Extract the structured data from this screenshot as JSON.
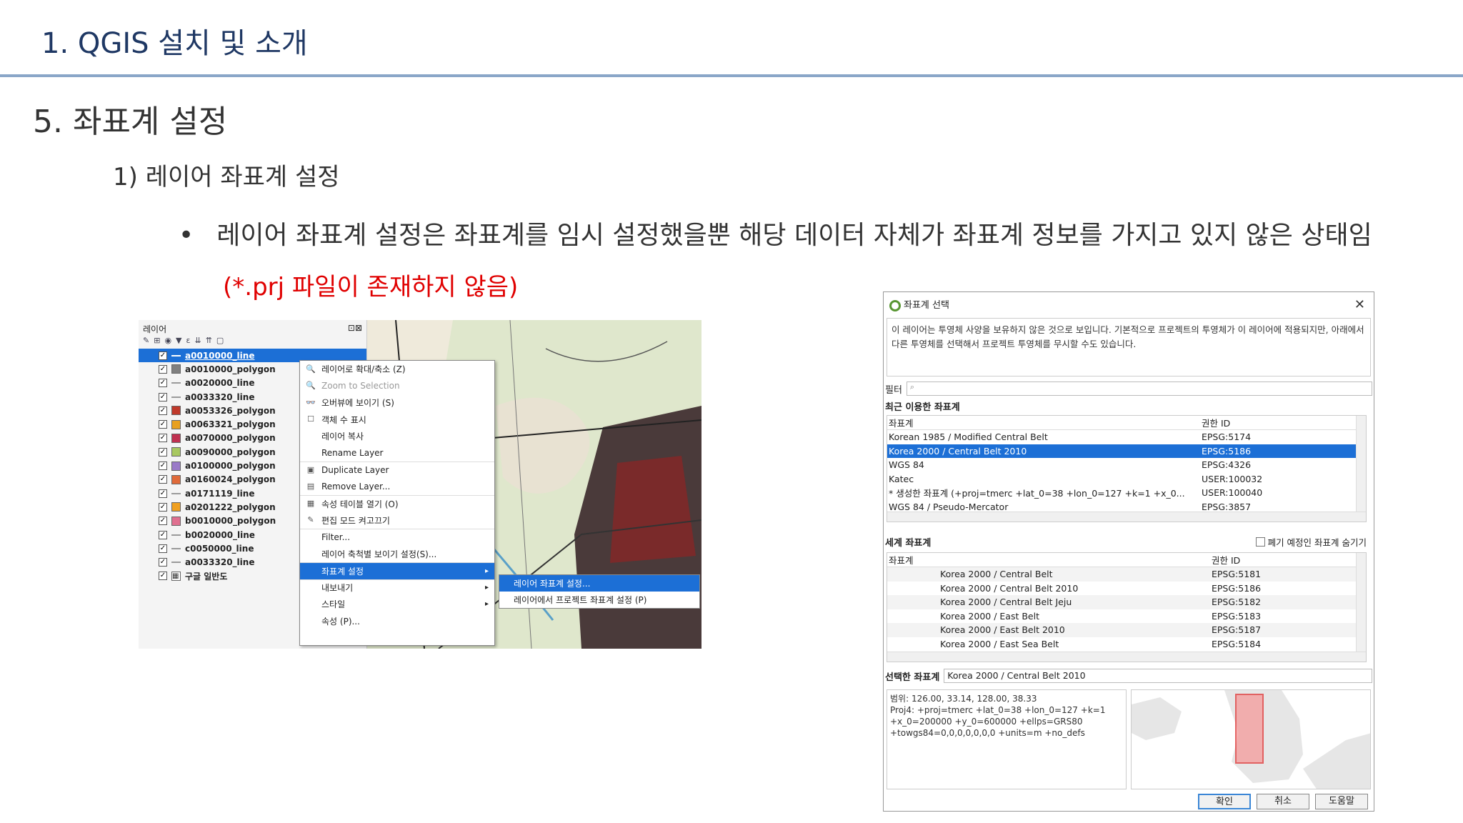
{
  "header": {
    "title": "1. QGIS 설치 및 소개"
  },
  "section": {
    "title": "5. 좌표계 설정",
    "subtitle": "1) 레이어 좌표계 설정"
  },
  "bullet": {
    "text": "레이어 좌표계 설정은  좌표계를 임시 설정했을뿐 해당 데이터 자체가 좌표계 정보를 가지고 있지 않은 상태임",
    "note": "(*.prj 파일이 존재하지 않음)"
  },
  "layers_panel": {
    "title": "레이어",
    "layers": [
      {
        "name": "a0010000_line",
        "type": "line",
        "color": "#ffffff",
        "selected": true
      },
      {
        "name": "a0010000_polygon",
        "type": "polygon",
        "color": "#808080"
      },
      {
        "name": "a0020000_line",
        "type": "line",
        "color": "#9a9a9a"
      },
      {
        "name": "a0033320_line",
        "type": "line",
        "color": "#9a9a9a"
      },
      {
        "name": "a0053326_polygon",
        "type": "polygon",
        "color": "#c0392b"
      },
      {
        "name": "a0063321_polygon",
        "type": "polygon",
        "color": "#e8a020"
      },
      {
        "name": "a0070000_polygon",
        "type": "polygon",
        "color": "#c03050"
      },
      {
        "name": "a0090000_polygon",
        "type": "polygon",
        "color": "#a8c860"
      },
      {
        "name": "a0100000_polygon",
        "type": "polygon",
        "color": "#9a7ac8"
      },
      {
        "name": "a0160024_polygon",
        "type": "polygon",
        "color": "#e06a3a"
      },
      {
        "name": "a0171119_line",
        "type": "line",
        "color": "#9a9a9a"
      },
      {
        "name": "a0201222_polygon",
        "type": "polygon",
        "color": "#f0a020"
      },
      {
        "name": "b0010000_polygon",
        "type": "polygon",
        "color": "#e07090"
      },
      {
        "name": "b0020000_line",
        "type": "line",
        "color": "#9a9a9a"
      },
      {
        "name": "c0050000_line",
        "type": "line",
        "color": "#9a9a9a"
      },
      {
        "name": "a0033320_line",
        "type": "line",
        "color": "#9a9a9a"
      },
      {
        "name": "구글 일반도",
        "type": "raster",
        "color": "#333333"
      }
    ]
  },
  "context_menu": {
    "items": [
      {
        "label": "레이어로 확대/축소 (Z)",
        "icon": "zoom-icon"
      },
      {
        "label": "Zoom to Selection",
        "icon": "zoom-selection-icon",
        "disabled": true
      },
      {
        "label": "오버뷰에 보이기 (S)",
        "icon": "overview-icon"
      },
      {
        "label": "객체 수 표시",
        "icon": "checkbox-icon"
      },
      {
        "label": "레이어 복사",
        "icon": ""
      },
      {
        "label": "Rename Layer",
        "icon": ""
      },
      {
        "label": "Duplicate Layer",
        "icon": "duplicate-icon"
      },
      {
        "label": "Remove Layer...",
        "icon": "remove-icon"
      },
      {
        "label": "속성 테이블 열기 (O)",
        "icon": "table-icon"
      },
      {
        "label": "편집 모드 켜고끄기",
        "icon": "pencil-icon"
      },
      {
        "label": "Filter...",
        "icon": ""
      },
      {
        "label": "레이어 축척별 보이기 설정(S)...",
        "icon": ""
      },
      {
        "label": "좌표계 설정",
        "icon": "",
        "highlight": true,
        "submenu": true
      },
      {
        "label": "내보내기",
        "icon": "",
        "submenu": true
      },
      {
        "label": "스타일",
        "icon": "",
        "submenu": true
      },
      {
        "label": "속성 (P)...",
        "icon": ""
      }
    ],
    "submenu": [
      {
        "label": "레이어 좌표계 설정...",
        "highlight": true
      },
      {
        "label": "레이어에서 프로젝트 좌표계 설정 (P)"
      }
    ]
  },
  "crs_dialog": {
    "title": "좌표계 선택",
    "message": "이 레이어는 투영체 사양을 보유하지 않은 것으로 보입니다. 기본적으로 프로젝트의 투영체가 이 레이어에 적용되지만, 아래에서 다른 투영체를 선택해서 프로젝트 투영체를 무시할 수도 있습니다.",
    "filter_label": "필터",
    "recent_label": "최근 이용한 좌표계",
    "recent_headers": [
      "좌표계",
      "권한 ID"
    ],
    "recent_rows": [
      {
        "name": "Korean 1985 / Modified Central Belt",
        "id": "EPSG:5174"
      },
      {
        "name": "Korea 2000 / Central Belt 2010",
        "id": "EPSG:5186",
        "selected": true
      },
      {
        "name": "WGS 84",
        "id": "EPSG:4326"
      },
      {
        "name": "Katec",
        "id": "USER:100032"
      },
      {
        "name": "* 생성한 좌표계 (+proj=tmerc +lat_0=38 +lon_0=127 +k=1 +x_0...",
        "id": "USER:100040"
      },
      {
        "name": "WGS 84 / Pseudo-Mercator",
        "id": "EPSG:3857"
      }
    ],
    "world_label": "세계 좌표계",
    "hide_deprecated": "폐기 예정인 좌표계 숨기기",
    "world_headers": [
      "좌표계",
      "권한 ID"
    ],
    "world_rows": [
      {
        "name": "Korea 2000 / Central Belt",
        "id": "EPSG:5181"
      },
      {
        "name": "Korea 2000 / Central Belt 2010",
        "id": "EPSG:5186"
      },
      {
        "name": "Korea 2000 / Central Belt Jeju",
        "id": "EPSG:5182"
      },
      {
        "name": "Korea 2000 / East Belt",
        "id": "EPSG:5183"
      },
      {
        "name": "Korea 2000 / East Belt 2010",
        "id": "EPSG:5187"
      },
      {
        "name": "Korea 2000 / East Sea Belt",
        "id": "EPSG:5184"
      }
    ],
    "selected_label": "선택한 좌표계",
    "selected_value": "Korea 2000 / Central Belt 2010",
    "info_lines": [
      "범위: 126.00, 33.14, 128.00, 38.33",
      "Proj4: +proj=tmerc +lat_0=38 +lon_0=127 +k=1",
      "+x_0=200000 +y_0=600000 +ellps=GRS80",
      "+towgs84=0,0,0,0,0,0,0 +units=m +no_defs"
    ],
    "buttons": {
      "ok": "확인",
      "cancel": "취소",
      "help": "도움말"
    }
  }
}
